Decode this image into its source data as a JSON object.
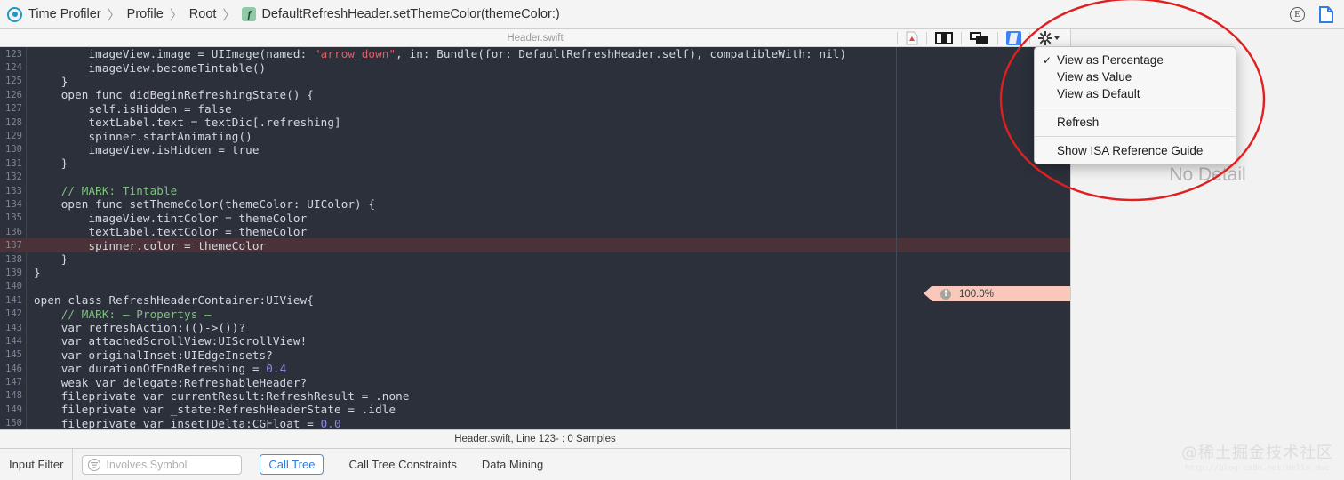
{
  "breadcrumb": {
    "items": [
      {
        "label": "Time Profiler",
        "icon": "target-icon"
      },
      {
        "label": "Profile",
        "icon": null
      },
      {
        "label": "Root",
        "icon": null
      },
      {
        "label": "DefaultRefreshHeader.setThemeColor(themeColor:)",
        "icon": "function-icon"
      }
    ],
    "separator": "〉",
    "func_glyph": "f",
    "right_icons": [
      {
        "name": "editor-options-icon",
        "glyph": "E"
      },
      {
        "name": "document-icon",
        "glyph": ""
      }
    ]
  },
  "editor_header": {
    "filename": "Header.swift",
    "tools": [
      {
        "name": "related-items-icon"
      },
      {
        "name": "standard-editor-icon"
      },
      {
        "name": "assistant-editor-icon"
      },
      {
        "name": "version-editor-icon"
      },
      {
        "name": "gear-menu-icon"
      }
    ]
  },
  "editor": {
    "highlighted_line": 137,
    "percent_badge": {
      "value": "100.0%",
      "warn_glyph": "!"
    },
    "lines": [
      {
        "n": 123,
        "src": "        imageView.image = UIImage(named: \"arrow_down\", in: Bundle(for: DefaultRefreshHeader.self), compatibleWith: nil)"
      },
      {
        "n": 124,
        "src": "        imageView.becomeTintable()"
      },
      {
        "n": 125,
        "src": "    }"
      },
      {
        "n": 126,
        "src": "    open func didBeginRefreshingState() {"
      },
      {
        "n": 127,
        "src": "        self.isHidden = false"
      },
      {
        "n": 128,
        "src": "        textLabel.text = textDic[.refreshing]"
      },
      {
        "n": 129,
        "src": "        spinner.startAnimating()"
      },
      {
        "n": 130,
        "src": "        imageView.isHidden = true"
      },
      {
        "n": 131,
        "src": "    }"
      },
      {
        "n": 132,
        "src": ""
      },
      {
        "n": 133,
        "src": "    // MARK: Tintable"
      },
      {
        "n": 134,
        "src": "    open func setThemeColor(themeColor: UIColor) {"
      },
      {
        "n": 135,
        "src": "        imageView.tintColor = themeColor"
      },
      {
        "n": 136,
        "src": "        textLabel.textColor = themeColor"
      },
      {
        "n": 137,
        "src": "        spinner.color = themeColor"
      },
      {
        "n": 138,
        "src": "    }"
      },
      {
        "n": 139,
        "src": "}"
      },
      {
        "n": 140,
        "src": ""
      },
      {
        "n": 141,
        "src": "open class RefreshHeaderContainer:UIView{"
      },
      {
        "n": 142,
        "src": "    // MARK: — Propertys —"
      },
      {
        "n": 143,
        "src": "    var refreshAction:(()->())?"
      },
      {
        "n": 144,
        "src": "    var attachedScrollView:UIScrollView!"
      },
      {
        "n": 145,
        "src": "    var originalInset:UIEdgeInsets?"
      },
      {
        "n": 146,
        "src": "    var durationOfEndRefreshing = 0.4"
      },
      {
        "n": 147,
        "src": "    weak var delegate:RefreshableHeader?"
      },
      {
        "n": 148,
        "src": "    fileprivate var currentResult:RefreshResult = .none"
      },
      {
        "n": 149,
        "src": "    fileprivate var _state:RefreshHeaderState = .idle"
      },
      {
        "n": 150,
        "src": "    fileprivate var insetTDelta:CGFloat = 0.0"
      }
    ]
  },
  "code_status": {
    "text": "Header.swift, Line 123- : 0 Samples"
  },
  "filter_bar": {
    "input_filter_label": "Input Filter",
    "symbol_placeholder": "Involves Symbol",
    "symbol_value": "",
    "call_tree_label": "Call Tree",
    "call_tree_constraints_label": "Call Tree Constraints",
    "data_mining_label": "Data Mining"
  },
  "detail_pane": {
    "empty_text": "No Detail"
  },
  "menu": {
    "items": [
      {
        "label": "View as Percentage",
        "checked": true
      },
      {
        "label": "View as Value",
        "checked": false
      },
      {
        "label": "View as Default",
        "checked": false
      },
      {
        "label": "Refresh",
        "checked": false
      },
      {
        "label": "Show ISA Reference Guide",
        "checked": false
      }
    ],
    "check_glyph": "✓"
  },
  "watermark": {
    "main": "@稀土掘金技术社区",
    "sub": "http://blog.csdn.net/Hello_Hwc"
  },
  "colors": {
    "editor_bg": "#2b303b",
    "highlight_row": "#4a3238",
    "badge_pink": "#fac7bb",
    "accent_blue": "#2f7de1",
    "annotation_red": "#e02020"
  }
}
